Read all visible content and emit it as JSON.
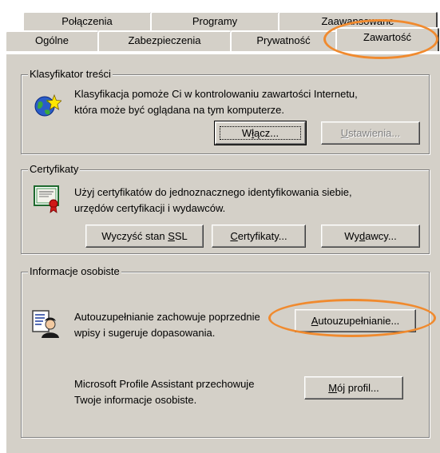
{
  "tabs_back": [
    "Połączenia",
    "Programy",
    "Zaawansowane"
  ],
  "tabs_front": [
    "Ogólne",
    "Zabezpieczenia",
    "Prywatność",
    "Zawartość"
  ],
  "content_advisor": {
    "title": "Klasyfikator treści",
    "desc_line1": "Klasyfikacja pomoże Ci w kontrolowaniu zawartości Internetu,",
    "desc_line2": "która może być oglądana na tym komputerze.",
    "enable_pre": "W",
    "enable_ul": "ł",
    "enable_post": "ącz...",
    "settings_ul": "U",
    "settings_post": "stawienia...",
    "icon": "globe-star-icon"
  },
  "certificates": {
    "title": "Certyfikaty",
    "desc_line1": "Użyj certyfikatów do jednoznacznego identyfikowania siebie,",
    "desc_line2": "urzędów certyfikacji i wydawców.",
    "clear_ssl_pre": "Wyczyść stan ",
    "clear_ssl_ul": "S",
    "clear_ssl_post": "SL",
    "certs_ul": "C",
    "certs_post": "ertyfikaty...",
    "publishers_pre": "Wy",
    "publishers_ul": "d",
    "publishers_post": "awcy...",
    "icon": "certificate-icon"
  },
  "personal_info": {
    "title": "Informacje osobiste",
    "autocomplete_line1": "Autouzupełnianie zachowuje poprzednie",
    "autocomplete_line2": "wpisy i sugeruje dopasowania.",
    "autocomplete_ul": "A",
    "autocomplete_post": "utouzupełnianie...",
    "profile_line1": "Microsoft Profile Assistant przechowuje",
    "profile_line2": "Twoje informacje osobiste.",
    "profile_ul": "M",
    "profile_post": "ój profil...",
    "icon": "profile-person-icon"
  },
  "colors": {
    "face": "#d4d0c8",
    "annotation": "#f08a2e",
    "disabled": "#808080"
  }
}
